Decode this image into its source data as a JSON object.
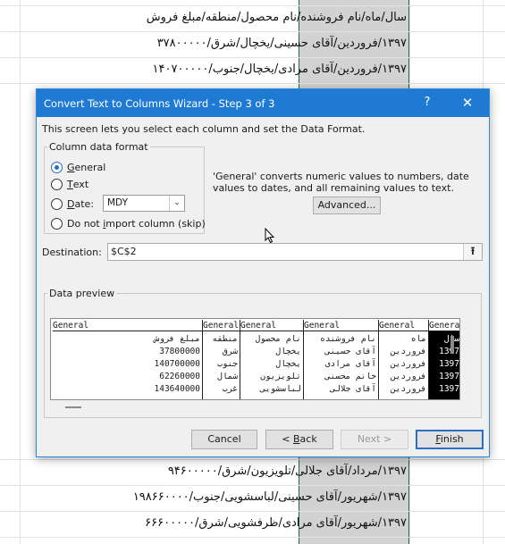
{
  "spreadsheet": {
    "rows_top": [
      "سال/ماه/نام فروشنده/نام محصول/منطقه/مبلغ فروش",
      "۱۳۹۷/فروردین/آقای حسینی/یخچال/شرق/۳۷۸۰۰۰۰۰",
      "۱۳۹۷/فروردین/آقای مرادی/یخچال/جنوب/۱۴۰۷۰۰۰۰۰"
    ],
    "rows_bottom": [
      "۱۳۹۷/مرداد/آقای جلالی/تلویزیون/شرق/۹۴۶۰۰۰۰۰",
      "۱۳۹۷/شهریور/آقای حسینی/لباسشویی/جنوب/۱۹۸۶۶۰۰۰۰",
      "۱۳۹۷/شهریور/آقای مرادی/ظرفشویی/شرق/۶۶۶۰۰۰۰۰"
    ]
  },
  "dialog": {
    "title": "Convert Text to Columns Wizard - Step 3 of 3",
    "help_label": "?",
    "close_label": "✕",
    "intro": "This screen lets you select each column and set the Data Format.",
    "column_format": {
      "legend": "Column data format",
      "options": [
        {
          "access": "G",
          "rest": "eneral",
          "prefix": "",
          "selected": true
        },
        {
          "access": "T",
          "rest": "ext",
          "prefix": "",
          "selected": false
        },
        {
          "access": "D",
          "rest": "ate:",
          "prefix": "",
          "selected": false
        },
        {
          "access": "i",
          "rest": "mport column (skip)",
          "prefix": "Do not ",
          "selected": false
        }
      ],
      "date_format_value": "MDY"
    },
    "explanation": "'General' converts numeric values to numbers, date values to dates, and all remaining values to text.",
    "advanced_button": "Advanced...",
    "destination": {
      "label": "Destination:",
      "value": "$C$2"
    },
    "preview": {
      "legend": "Data preview",
      "headers": [
        "General",
        "General",
        "General",
        "General",
        "General",
        "General"
      ],
      "rows": [
        [
          "مبلغ فروش",
          "منطقه",
          "نام محصول",
          "نام فروشنده",
          "ماه",
          "سال"
        ],
        [
          "37800000",
          "شرق",
          "یخچال",
          "آقای حسینی",
          "فروردین",
          "1397"
        ],
        [
          "140700000",
          "جنوب",
          "یخچال",
          "آقای مرادی",
          "فروردین",
          "1397"
        ],
        [
          "62260000",
          "شمال",
          "تلویزیون",
          "خانم محسنی",
          "فروردین",
          "1397"
        ],
        [
          "143640000",
          "غرب",
          "لباسشویی",
          "آقای جلالی",
          "فروردین",
          "1397"
        ]
      ]
    },
    "buttons": {
      "cancel": "Cancel",
      "back_prefix": "< ",
      "back_access": "B",
      "back_rest": "ack",
      "next": "Next >",
      "finish_access": "F",
      "finish_rest": "inish"
    }
  },
  "colors": {
    "title_bar": "#1f7ad4",
    "selection_border": "#1d6b3e",
    "selected_column": "#d2d2d2"
  }
}
